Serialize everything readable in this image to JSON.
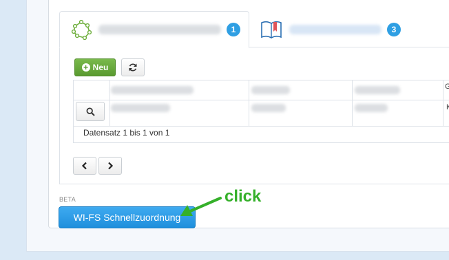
{
  "tabs": [
    {
      "badge": "1"
    },
    {
      "badge": "3"
    }
  ],
  "toolbar": {
    "new_label": "Neu"
  },
  "grid": {
    "header_cut_text": "G",
    "row_cut_text": "K"
  },
  "records_text": "Datensatz 1 bis 1 von 1",
  "beta_label": "BETA",
  "quick_button_label": "WI-FS Schnellzuordnung",
  "annotation_label": "click",
  "colors": {
    "accent_blue": "#2f9fe3",
    "green_button": "#5a9a30",
    "annotation_green": "#35b02a",
    "book_icon_red": "#e0555a"
  },
  "icons": [
    "polygon-icon",
    "book-icon",
    "plus-circle-icon",
    "refresh-icon",
    "search-icon",
    "chevron-left-icon",
    "chevron-right-icon",
    "arrow-icon"
  ]
}
